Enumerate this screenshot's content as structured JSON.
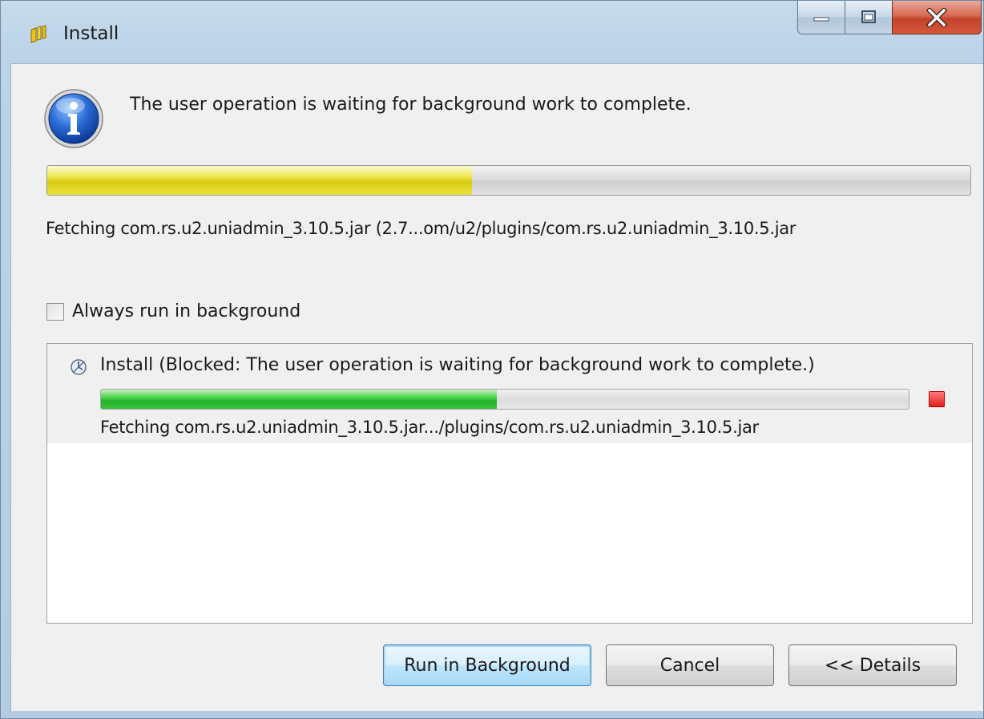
{
  "window": {
    "title": "Install",
    "caption": {
      "minimize_icon": "minimize-icon",
      "maximize_icon": "maximize-icon",
      "close_icon": "close-icon"
    }
  },
  "dialog": {
    "message": "The user operation is waiting for background work to complete.",
    "progress": 0.46,
    "progress_color": "#e8e040",
    "fetch_text": "Fetching com.rs.u2.uniadmin_3.10.5.jar (2.7...om/u2/plugins/com.rs.u2.uniadmin_3.10.5.jar"
  },
  "always_run_checkbox": {
    "label": "Always run in background",
    "checked": false
  },
  "jobs": [
    {
      "title": "Install (Blocked: The user operation is waiting for background work to complete.)",
      "progress": 0.49,
      "progress_color": "#22b22a",
      "detail": "Fetching com.rs.u2.uniadmin_3.10.5.jar.../plugins/com.rs.u2.uniadmin_3.10.5.jar"
    }
  ],
  "buttons": {
    "run_in_background": "Run in Background",
    "cancel": "Cancel",
    "details": "<< Details"
  }
}
